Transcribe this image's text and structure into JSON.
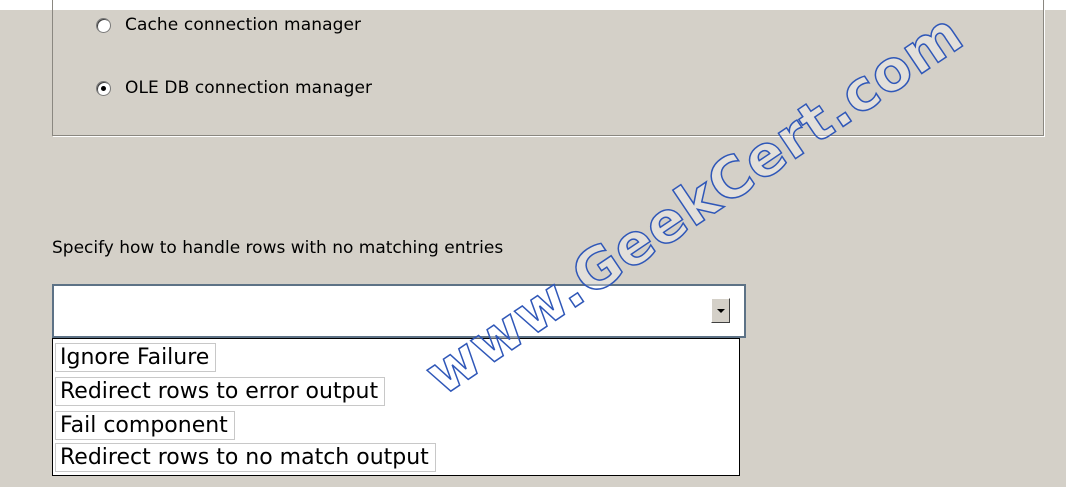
{
  "connection_type": {
    "options": [
      {
        "label": "Cache connection manager",
        "checked": false
      },
      {
        "label": "OLE DB connection manager",
        "checked": true
      }
    ]
  },
  "no_match": {
    "prompt": "Specify how to handle rows with no matching entries",
    "selected_value": "",
    "dropdown_icon": "chevron-down-icon",
    "options": [
      "Ignore Failure",
      "Redirect rows to error output",
      "Fail component",
      "Redirect rows to no match output"
    ]
  },
  "watermark": {
    "text": "www.GeekCert.com"
  },
  "colors": {
    "dialog_background": "#d4d0c8",
    "combo_border": "#5d7286",
    "watermark_outline": "#2f57b8"
  }
}
